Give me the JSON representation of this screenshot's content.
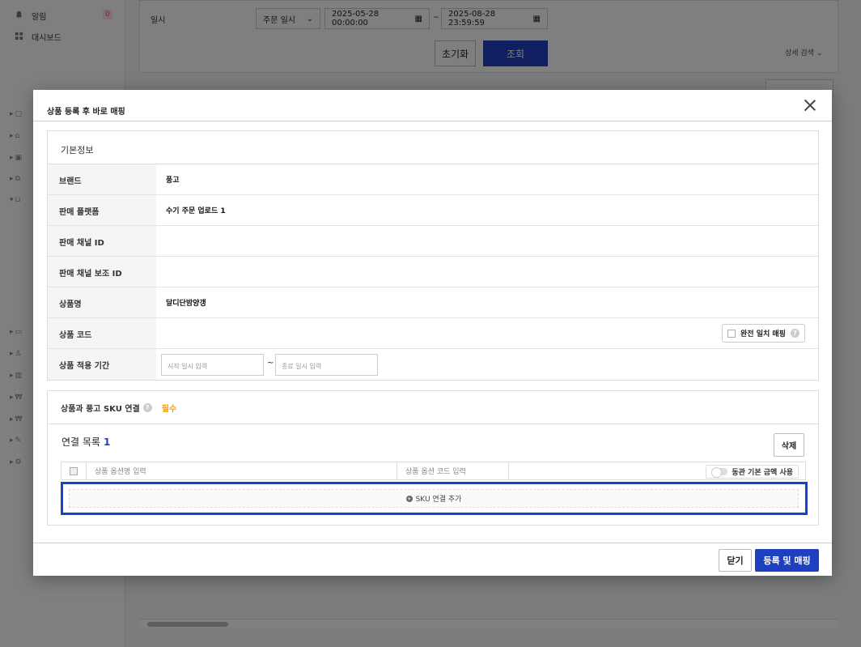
{
  "sidebar": {
    "alarm_label": "알림",
    "alarm_count": "0",
    "dashboard_label": "대시보드"
  },
  "filter": {
    "date_label": "일시",
    "date_type": "주문 일시",
    "date_start": "2025-05-28 00:00:00",
    "date_end": "2025-08-28 23:59:59",
    "tilde": "~",
    "reset_label": "초기화",
    "search_label": "조회",
    "detail_search_label": "상세 검색"
  },
  "modal": {
    "title": "상품 등록 후 바로 매핑",
    "basic_section_title": "기본정보",
    "rows": [
      {
        "label": "브랜드",
        "value": "풍고"
      },
      {
        "label": "판매 플랫폼",
        "value": "수기 주문 업로드 1"
      },
      {
        "label": "판매 채널 ID",
        "value": ""
      },
      {
        "label": "판매 채널 보조 ID",
        "value": ""
      },
      {
        "label": "상품명",
        "value": "달디단밤양갱"
      },
      {
        "label": "상품 코드",
        "value": ""
      },
      {
        "label": "상품 적용 기간",
        "value": ""
      }
    ],
    "exact_match_label": "완전 일치 매핑",
    "start_date_placeholder": "시작 일시 입력",
    "end_date_placeholder": "종료 일시 입력",
    "date_tilde": "~",
    "sku_section_title": "상품과 풍고 SKU 연결",
    "required_label": "필수",
    "link_list_label": "연결 목록",
    "link_count": "1",
    "delete_label": "삭제",
    "table_headers": {
      "option_name": "상품 옵션명 입력",
      "option_code": "상품 옵션 코드 입력"
    },
    "toggle_label": "동관 기본 금액 사용",
    "add_sku_label": "SKU 연결 추가",
    "close_label": "닫기",
    "submit_label": "등록 및 매핑"
  },
  "colors": {
    "primary": "#1e3fbf",
    "highlight_outline": "#1047c8",
    "required": "#f5a000"
  }
}
